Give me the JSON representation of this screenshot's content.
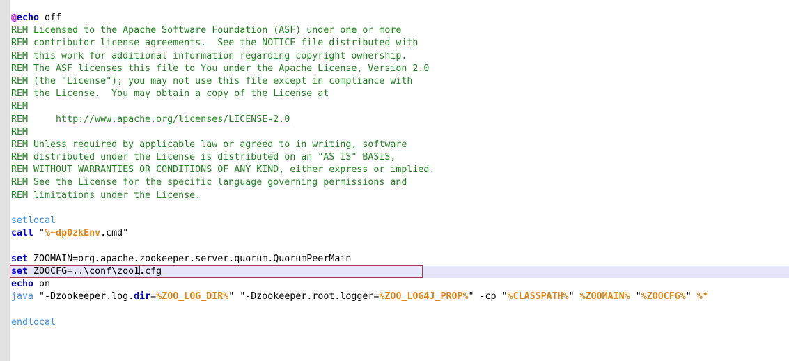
{
  "document": {
    "language": "batch",
    "colors": {
      "background": "#ffffff",
      "gutter": "#e1e1e1",
      "current_line": "#e6e6fa",
      "edit_box_border": "#a83a50",
      "comment": "#218021",
      "keyword": "#0000c8",
      "keyword_alt": "#3a8ee6",
      "variable": "#e08214",
      "at_symbol": "#d020d0",
      "caret": "#31317f",
      "plain": "#000000"
    }
  },
  "lines": [
    {
      "tokens": [
        {
          "t": "@",
          "c": "at"
        },
        {
          "t": "echo",
          "c": "kw"
        },
        {
          "t": " off",
          "c": "plain"
        }
      ]
    },
    {
      "tokens": [
        {
          "t": "REM Licensed to the Apache Software Foundation (ASF) under one or more",
          "c": "comment"
        }
      ]
    },
    {
      "tokens": [
        {
          "t": "REM contributor license agreements.  See the NOTICE file distributed with",
          "c": "comment"
        }
      ]
    },
    {
      "tokens": [
        {
          "t": "REM this work for additional information regarding copyright ownership.",
          "c": "comment"
        }
      ]
    },
    {
      "tokens": [
        {
          "t": "REM The ASF licenses this file to You under the Apache License, Version 2.0",
          "c": "comment"
        }
      ]
    },
    {
      "tokens": [
        {
          "t": "REM (the \"License\"); you may not use this file except in compliance with",
          "c": "comment"
        }
      ]
    },
    {
      "tokens": [
        {
          "t": "REM the License.  You may obtain a copy of the License at",
          "c": "comment"
        }
      ]
    },
    {
      "tokens": [
        {
          "t": "REM",
          "c": "comment"
        }
      ]
    },
    {
      "tokens": [
        {
          "t": "REM     ",
          "c": "comment"
        },
        {
          "t": "http://www.apache.org/licenses/LICENSE-2.0",
          "c": "url"
        }
      ]
    },
    {
      "tokens": [
        {
          "t": "REM",
          "c": "comment"
        }
      ]
    },
    {
      "tokens": [
        {
          "t": "REM Unless required by applicable law or agreed to in writing, software",
          "c": "comment"
        }
      ]
    },
    {
      "tokens": [
        {
          "t": "REM distributed under the License is distributed on an \"AS IS\" BASIS,",
          "c": "comment"
        }
      ]
    },
    {
      "tokens": [
        {
          "t": "REM WITHOUT WARRANTIES OR CONDITIONS OF ANY KIND, either express or implied.",
          "c": "comment"
        }
      ]
    },
    {
      "tokens": [
        {
          "t": "REM See the License for the specific language governing permissions and",
          "c": "comment"
        }
      ]
    },
    {
      "tokens": [
        {
          "t": "REM limitations under the License.",
          "c": "comment"
        }
      ]
    },
    {
      "tokens": []
    },
    {
      "tokens": [
        {
          "t": "setlocal",
          "c": "kw2"
        }
      ]
    },
    {
      "tokens": [
        {
          "t": "call",
          "c": "kw"
        },
        {
          "t": " \"",
          "c": "plain"
        },
        {
          "t": "%~dp0zkEnv",
          "c": "var"
        },
        {
          "t": ".cmd\"",
          "c": "plain"
        }
      ]
    },
    {
      "tokens": []
    },
    {
      "tokens": [
        {
          "t": "set",
          "c": "kw"
        },
        {
          "t": " ZOOMAIN=org.apache.zookeeper.server.quorum.QuorumPeerMain",
          "c": "plain"
        }
      ]
    },
    {
      "current": true,
      "editbox": true,
      "tokens": [
        {
          "t": "set",
          "c": "kw"
        },
        {
          "t": " ZOOCFG=..\\conf\\zoo1",
          "c": "plain"
        },
        {
          "t": "",
          "c": "caret"
        },
        {
          "t": ".cfg",
          "c": "plain"
        }
      ]
    },
    {
      "tokens": [
        {
          "t": "echo",
          "c": "kw"
        },
        {
          "t": " on",
          "c": "plain"
        }
      ]
    },
    {
      "tokens": [
        {
          "t": "java",
          "c": "kw2"
        },
        {
          "t": " \"-Dzookeeper.log.",
          "c": "plain"
        },
        {
          "t": "dir",
          "c": "prop"
        },
        {
          "t": "=",
          "c": "plain"
        },
        {
          "t": "%ZOO_LOG_DIR%",
          "c": "var"
        },
        {
          "t": "\" \"-Dzookeeper.root.logger=",
          "c": "plain"
        },
        {
          "t": "%ZOO_LOG4J_PROP%",
          "c": "var"
        },
        {
          "t": "\" -cp \"",
          "c": "plain"
        },
        {
          "t": "%CLASSPATH%",
          "c": "var"
        },
        {
          "t": "\" ",
          "c": "plain"
        },
        {
          "t": "%ZOOMAIN%",
          "c": "var"
        },
        {
          "t": " \"",
          "c": "plain"
        },
        {
          "t": "%ZOOCFG%",
          "c": "var"
        },
        {
          "t": "\" ",
          "c": "plain"
        },
        {
          "t": "%*",
          "c": "var"
        }
      ]
    },
    {
      "tokens": []
    },
    {
      "tokens": [
        {
          "t": "endlocal",
          "c": "kw2"
        }
      ]
    }
  ]
}
